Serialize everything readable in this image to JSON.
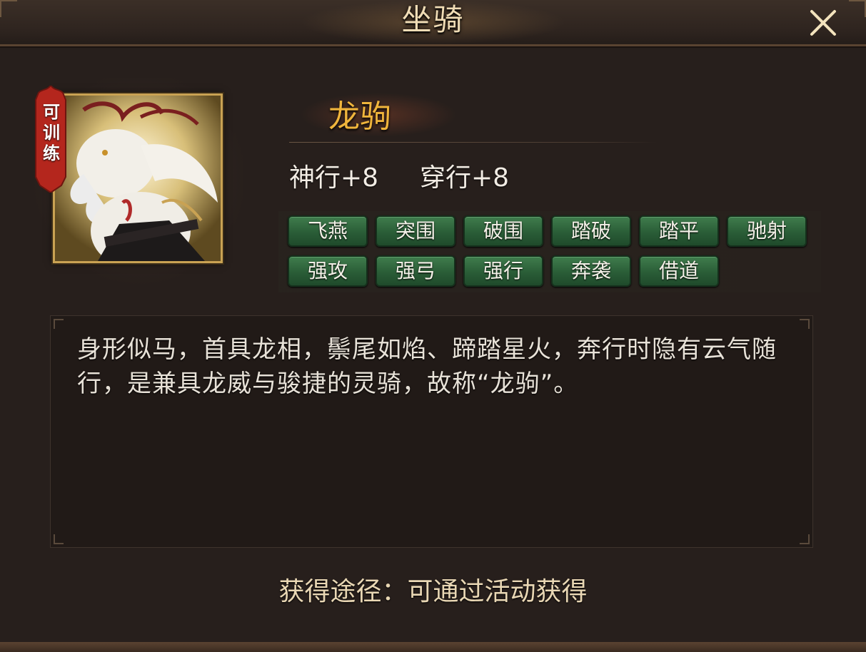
{
  "window": {
    "title": "坐骑"
  },
  "mount": {
    "name": "龙驹",
    "trainable_label": "可训练",
    "stats": [
      {
        "text": "神行+8"
      },
      {
        "text": "穿行+8"
      }
    ],
    "skills": [
      "飞燕",
      "突围",
      "破围",
      "踏破",
      "踏平",
      "驰射",
      "强攻",
      "强弓",
      "强行",
      "奔袭",
      "借道"
    ],
    "description": "身形似马，首具龙相，鬃尾如焰、蹄踏星火，奔行时隐有云气随行，是兼具龙威与骏捷的灵骑，故称“龙驹”。"
  },
  "footer": {
    "acquire_text": "获得途径：可通过活动获得"
  },
  "colors": {
    "name": "#f0b53c",
    "skill_tag": "#2a5d37",
    "frame_gold": "#c9a253"
  }
}
